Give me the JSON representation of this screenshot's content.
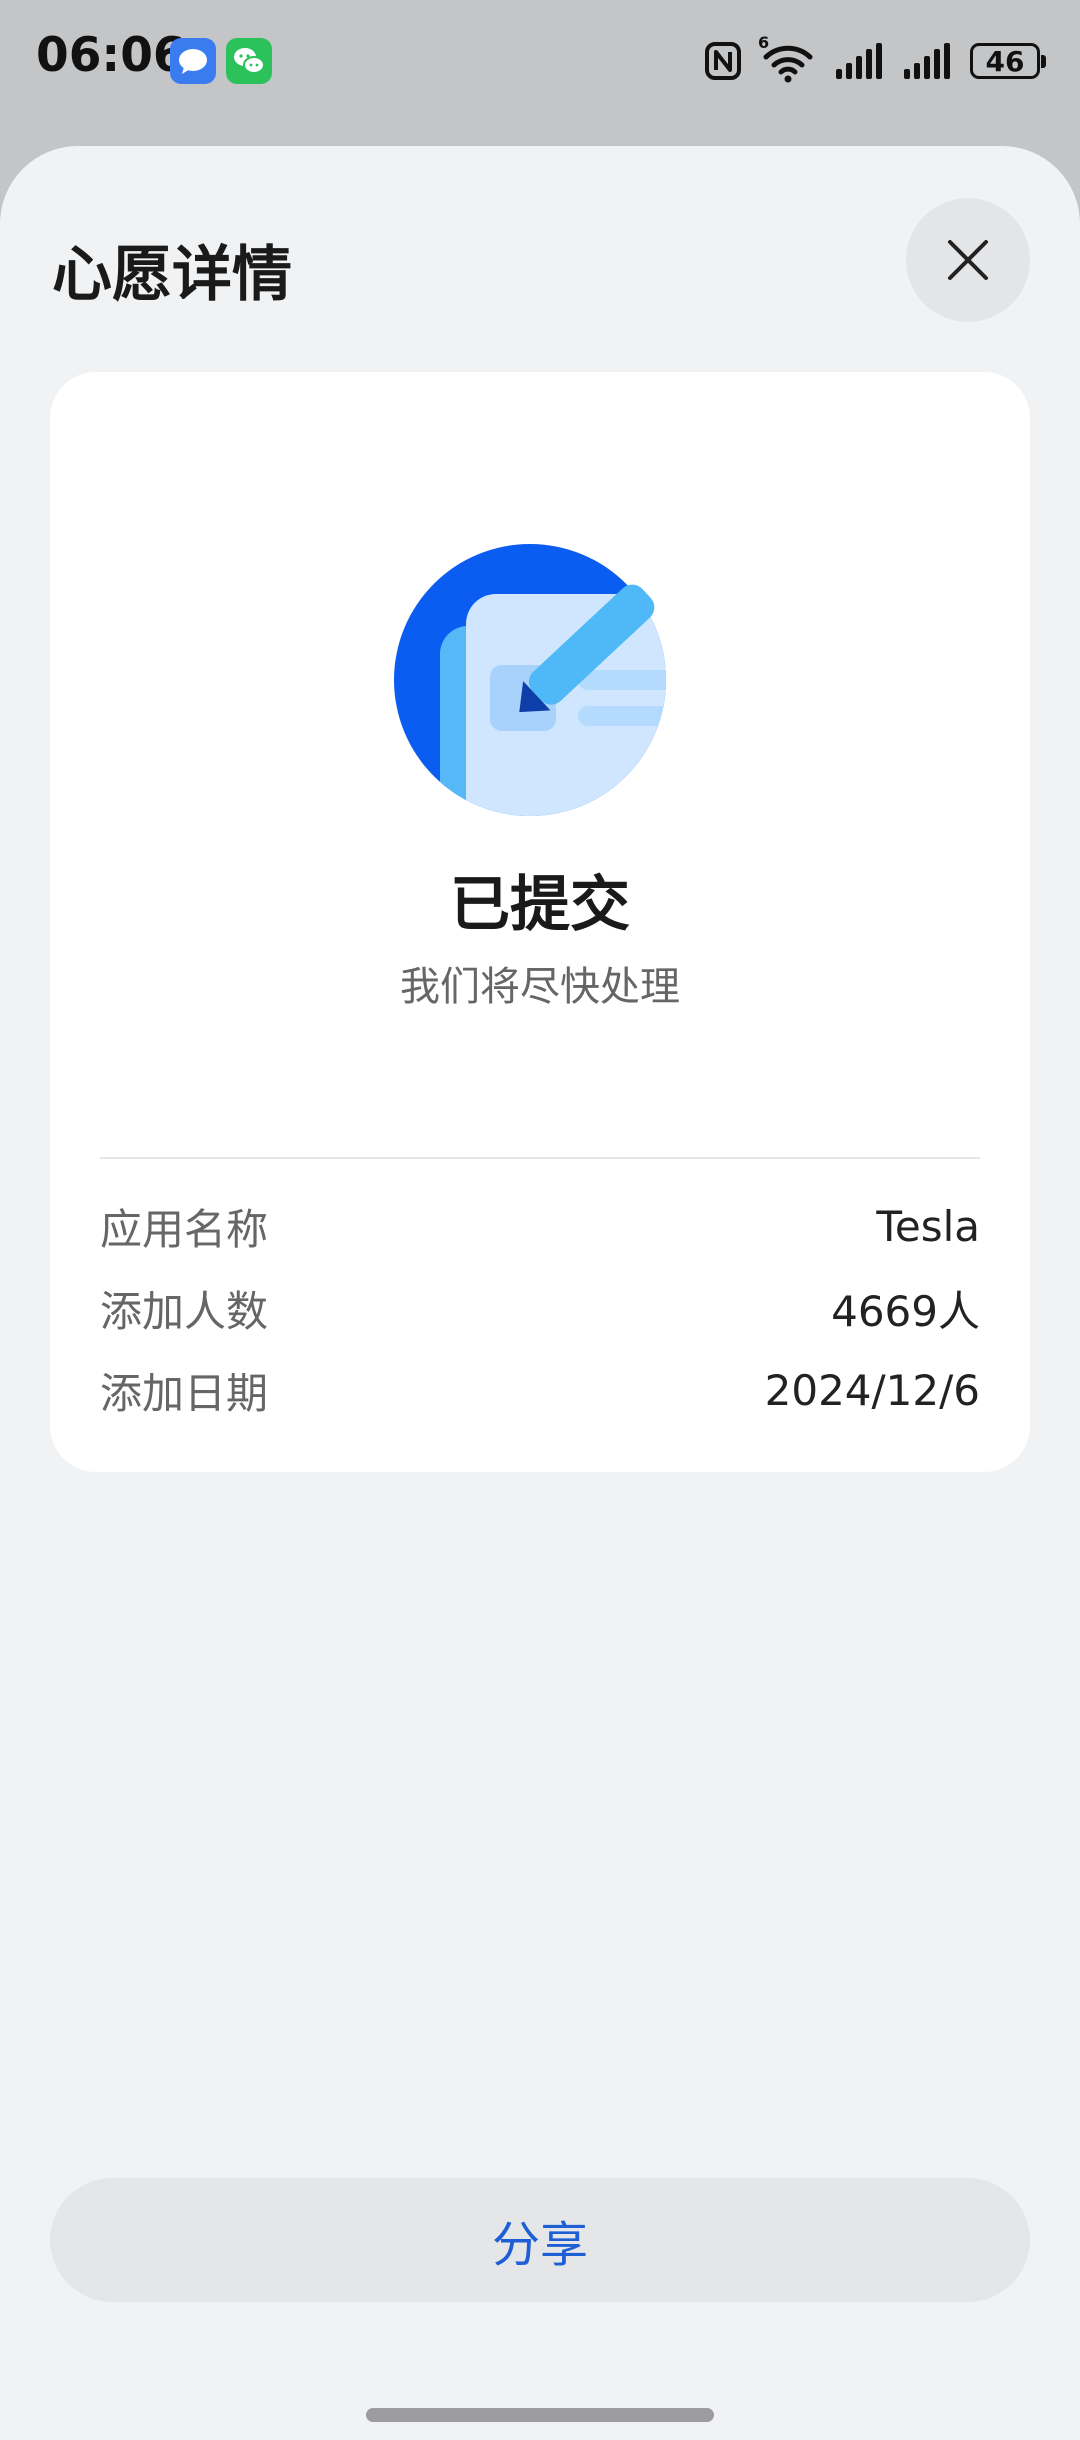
{
  "status_bar": {
    "time": "06:06",
    "notifications": [
      "message-icon",
      "wechat-icon"
    ],
    "signal_badge": "6",
    "battery": "46"
  },
  "sheet": {
    "title": "心愿详情",
    "close_icon": "close-icon"
  },
  "result": {
    "title": "已提交",
    "subtitle": "我们将尽快处理"
  },
  "details": [
    {
      "label": "应用名称",
      "value": "Tesla"
    },
    {
      "label": "添加人数",
      "value": "4669人"
    },
    {
      "label": "添加日期",
      "value": "2024/12/6"
    }
  ],
  "share_label": "分享",
  "colors": {
    "accent": "#1f5fd6",
    "illustration_blue": "#0b5cf0",
    "illustration_light": "#cfe6fe",
    "pen": "#4fb9f7"
  }
}
